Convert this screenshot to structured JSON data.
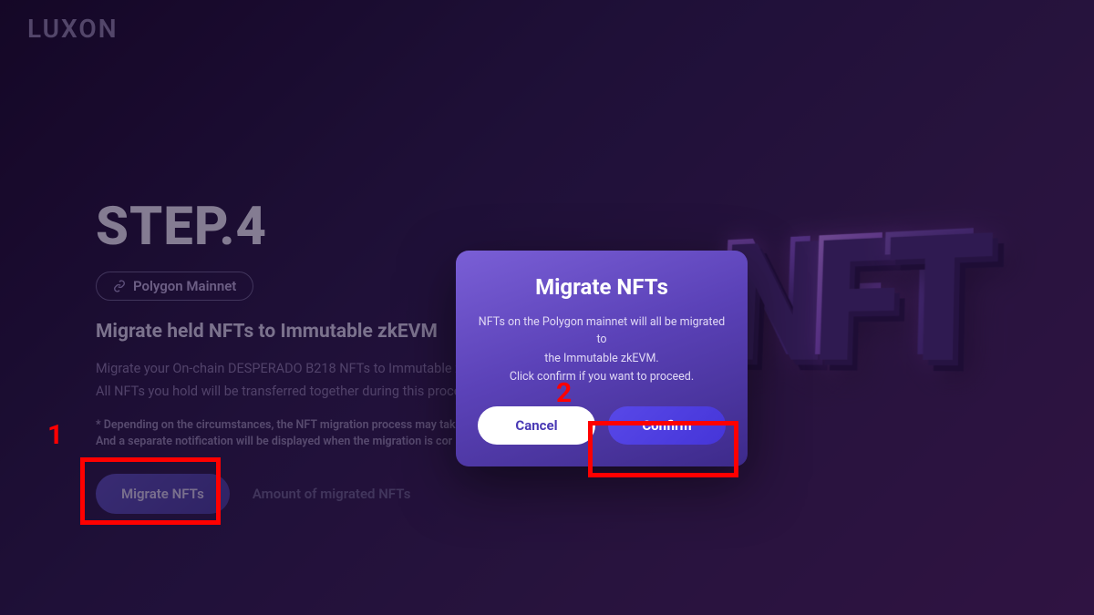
{
  "brand": "LUXON",
  "step": {
    "title": "STEP.4",
    "network": "Polygon Mainnet"
  },
  "subtitle": "Migrate held NFTs to Immutable zkEVM",
  "desc": {
    "line1": "Migrate your On-chain DESPERADO B218 NFTs to Immutable zkEVM",
    "line2": "All NFTs you hold will be transferred together during this process."
  },
  "notes": {
    "line1": "* Depending on the circumstances, the NFT migration process may tak",
    "line2": "And a separate notification will be displayed when the migration is cor"
  },
  "buttons": {
    "migrate": "Migrate NFTs",
    "amount": "Amount of migrated NFTs"
  },
  "modal": {
    "title": "Migrate NFTs",
    "line1": "NFTs on the Polygon mainnet will all be migrated to",
    "line2": "the Immutable zkEVM.",
    "line3": "Click confirm if you want to proceed.",
    "cancel": "Cancel",
    "confirm": "Confirm"
  },
  "callouts": {
    "n1": "1",
    "n2": "2"
  },
  "nft3d": {
    "n": "N",
    "f": "F",
    "t": "T"
  }
}
